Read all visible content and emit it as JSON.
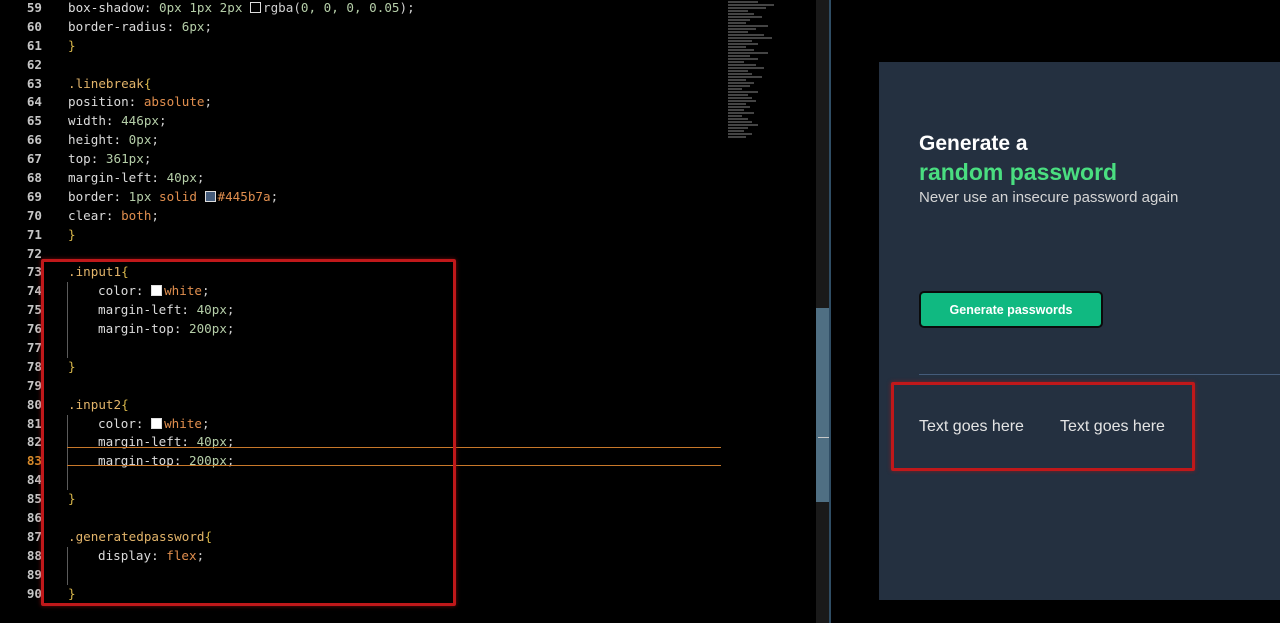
{
  "editor": {
    "lines": [
      {
        "n": "59",
        "parts": [
          [
            "t-prop",
            "box-shadow: "
          ],
          [
            "t-num",
            "0px 1px 2px "
          ],
          [
            "swatch",
            ""
          ],
          [
            "t-str",
            "rgba("
          ],
          [
            "t-num",
            "0, 0, 0, 0.05"
          ],
          [
            "t-str",
            ");"
          ]
        ]
      },
      {
        "n": "60",
        "parts": [
          [
            "t-prop",
            "border-radius: "
          ],
          [
            "t-num",
            "6px"
          ],
          [
            "t-str",
            ";"
          ]
        ]
      },
      {
        "n": "61",
        "parts": [
          [
            "t-brace",
            "}"
          ]
        ]
      },
      {
        "n": "62",
        "parts": []
      },
      {
        "n": "63",
        "parts": [
          [
            "t-sel",
            ".linebreak"
          ],
          [
            "t-brace",
            "{"
          ]
        ]
      },
      {
        "n": "64",
        "parts": [
          [
            "t-prop",
            "position: "
          ],
          [
            "t-kw",
            "absolute"
          ],
          [
            "t-str",
            ";"
          ]
        ]
      },
      {
        "n": "65",
        "parts": [
          [
            "t-prop",
            "width: "
          ],
          [
            "t-num",
            "446px"
          ],
          [
            "t-str",
            ";"
          ]
        ]
      },
      {
        "n": "66",
        "parts": [
          [
            "t-prop",
            "height: "
          ],
          [
            "t-num",
            "0px"
          ],
          [
            "t-str",
            ";"
          ]
        ]
      },
      {
        "n": "67",
        "parts": [
          [
            "t-prop",
            "top: "
          ],
          [
            "t-num",
            "361px"
          ],
          [
            "t-str",
            ";"
          ]
        ]
      },
      {
        "n": "68",
        "parts": [
          [
            "t-prop",
            "margin-left: "
          ],
          [
            "t-num",
            "40px"
          ],
          [
            "t-str",
            ";"
          ]
        ]
      },
      {
        "n": "69",
        "parts": [
          [
            "t-prop",
            "border: "
          ],
          [
            "t-num",
            "1px "
          ],
          [
            "t-kw",
            "solid "
          ],
          [
            "swatch-blue",
            ""
          ],
          [
            "t-kw",
            "#445b7a"
          ],
          [
            "t-str",
            ";"
          ]
        ]
      },
      {
        "n": "70",
        "parts": [
          [
            "t-prop",
            "clear: "
          ],
          [
            "t-kw",
            "both"
          ],
          [
            "t-str",
            ";"
          ]
        ]
      },
      {
        "n": "71",
        "parts": [
          [
            "t-brace",
            "}"
          ]
        ]
      },
      {
        "n": "72",
        "parts": []
      },
      {
        "n": "73",
        "parts": [
          [
            "t-sel",
            ".input1"
          ],
          [
            "t-brace",
            "{"
          ]
        ]
      },
      {
        "n": "74",
        "indent": true,
        "parts": [
          [
            "t-prop",
            "color: "
          ],
          [
            "swatch-white",
            ""
          ],
          [
            "t-kw",
            "white"
          ],
          [
            "t-str",
            ";"
          ]
        ]
      },
      {
        "n": "75",
        "indent": true,
        "parts": [
          [
            "t-prop",
            "margin-left: "
          ],
          [
            "t-num",
            "40px"
          ],
          [
            "t-str",
            ";"
          ]
        ]
      },
      {
        "n": "76",
        "indent": true,
        "parts": [
          [
            "t-prop",
            "margin-top: "
          ],
          [
            "t-num",
            "200px"
          ],
          [
            "t-str",
            ";"
          ]
        ]
      },
      {
        "n": "77",
        "indent": true,
        "parts": []
      },
      {
        "n": "78",
        "parts": [
          [
            "t-brace",
            "}"
          ]
        ]
      },
      {
        "n": "79",
        "parts": []
      },
      {
        "n": "80",
        "parts": [
          [
            "t-sel",
            ".input2"
          ],
          [
            "t-brace",
            "{"
          ]
        ]
      },
      {
        "n": "81",
        "indent": true,
        "parts": [
          [
            "t-prop",
            "color: "
          ],
          [
            "swatch-white",
            ""
          ],
          [
            "t-kw",
            "white"
          ],
          [
            "t-str",
            ";"
          ]
        ]
      },
      {
        "n": "82",
        "indent": true,
        "parts": [
          [
            "t-prop",
            "margin-left: "
          ],
          [
            "t-num",
            "40px"
          ],
          [
            "t-str",
            ";"
          ]
        ]
      },
      {
        "n": "83",
        "indent": true,
        "active": true,
        "parts": [
          [
            "t-prop",
            "margin-top: "
          ],
          [
            "t-num",
            "200px"
          ],
          [
            "t-str",
            ";"
          ]
        ]
      },
      {
        "n": "84",
        "indent": true,
        "parts": []
      },
      {
        "n": "85",
        "parts": [
          [
            "t-brace",
            "}"
          ]
        ]
      },
      {
        "n": "86",
        "parts": []
      },
      {
        "n": "87",
        "parts": [
          [
            "t-sel",
            ".generatedpassword"
          ],
          [
            "t-brace",
            "{"
          ]
        ]
      },
      {
        "n": "88",
        "indent": true,
        "parts": [
          [
            "t-prop",
            "display: "
          ],
          [
            "t-kw",
            "flex"
          ],
          [
            "t-str",
            ";"
          ]
        ]
      },
      {
        "n": "89",
        "indent": true,
        "parts": []
      },
      {
        "n": "90",
        "parts": [
          [
            "t-brace",
            "}"
          ]
        ]
      }
    ]
  },
  "preview": {
    "heading_line1": "Generate a",
    "heading_line2": "random password",
    "subtitle": "Never use an insecure password again",
    "button_label": "Generate passwords",
    "password1": "Text goes here",
    "password2": "Text goes here"
  },
  "colors": {
    "card_bg": "#243040",
    "accent_green": "#4ade80",
    "button_green": "#10b981",
    "divider": "#445b7a",
    "annotation_red": "#c0181a"
  }
}
